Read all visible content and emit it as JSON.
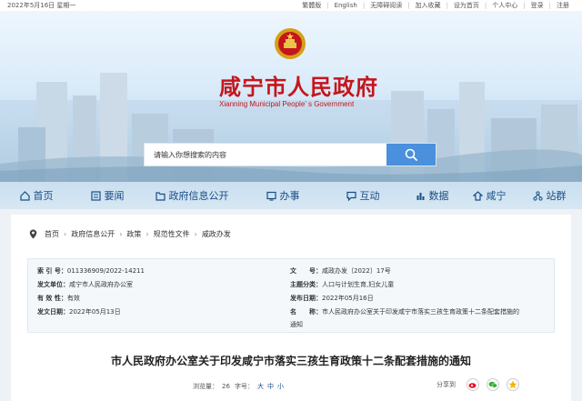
{
  "topbar": {
    "date": "2022年5月16日 星期一",
    "links": [
      "繁體版",
      "English",
      "无障碍阅读",
      "加入收藏",
      "设为首页",
      "个人中心",
      "登录",
      "注册"
    ]
  },
  "header": {
    "site_title": "咸宁市人民政府",
    "site_subtitle": "Xianning Municipal People’ s Government",
    "search_placeholder": "请输入你想搜索的内容"
  },
  "nav": {
    "items": [
      {
        "label": "首页",
        "icon": "home-icon"
      },
      {
        "label": "要闻",
        "icon": "news-icon"
      },
      {
        "label": "政府信息公开",
        "icon": "folder-icon"
      },
      {
        "label": "办事",
        "icon": "service-icon"
      },
      {
        "label": "互动",
        "icon": "chat-icon"
      },
      {
        "label": "数据",
        "icon": "chart-icon"
      },
      {
        "label": "咸宁",
        "icon": "city-icon"
      },
      {
        "label": "站群",
        "icon": "sites-icon"
      }
    ]
  },
  "breadcrumb": [
    "首页",
    "政府信息公开",
    "政策",
    "规范性文件",
    "咸政办发"
  ],
  "meta": {
    "index_label": "索 引 号：",
    "index_value": "011336909/2022-14211",
    "issuer_label": "发文单位：",
    "issuer_value": "咸宁市人民政府办公室",
    "validity_label": "有 效 性：",
    "validity_value": "有效",
    "issue_date_label": "发文日期：",
    "issue_date_value": "2022年05月13日",
    "doc_no_label": "文　　号：",
    "doc_no_value": "咸政办发〔2022〕17号",
    "topic_label": "主题分类：",
    "topic_value": "人口与计划生育,妇女儿童",
    "publish_date_label": "发布日期：",
    "publish_date_value": "2022年05月16日",
    "name_label": "名　　称：",
    "name_value_line1": "市人民政府办公室关于印发咸宁市落实三孩生育政策十二条配套措施的",
    "name_value_line2": "通知"
  },
  "document": {
    "title": "市人民政府办公室关于印发咸宁市落实三孩生育政策十二条配套措施的通知",
    "views_label": "浏览量：",
    "views_value": "26",
    "font_label": "字号：",
    "font_large": "大",
    "font_medium": "中",
    "font_small": "小",
    "share_label": "分享到"
  },
  "colors": {
    "title_red": "#c4161c",
    "nav_blue": "#1a4d86",
    "search_blue": "#4a90dc"
  }
}
